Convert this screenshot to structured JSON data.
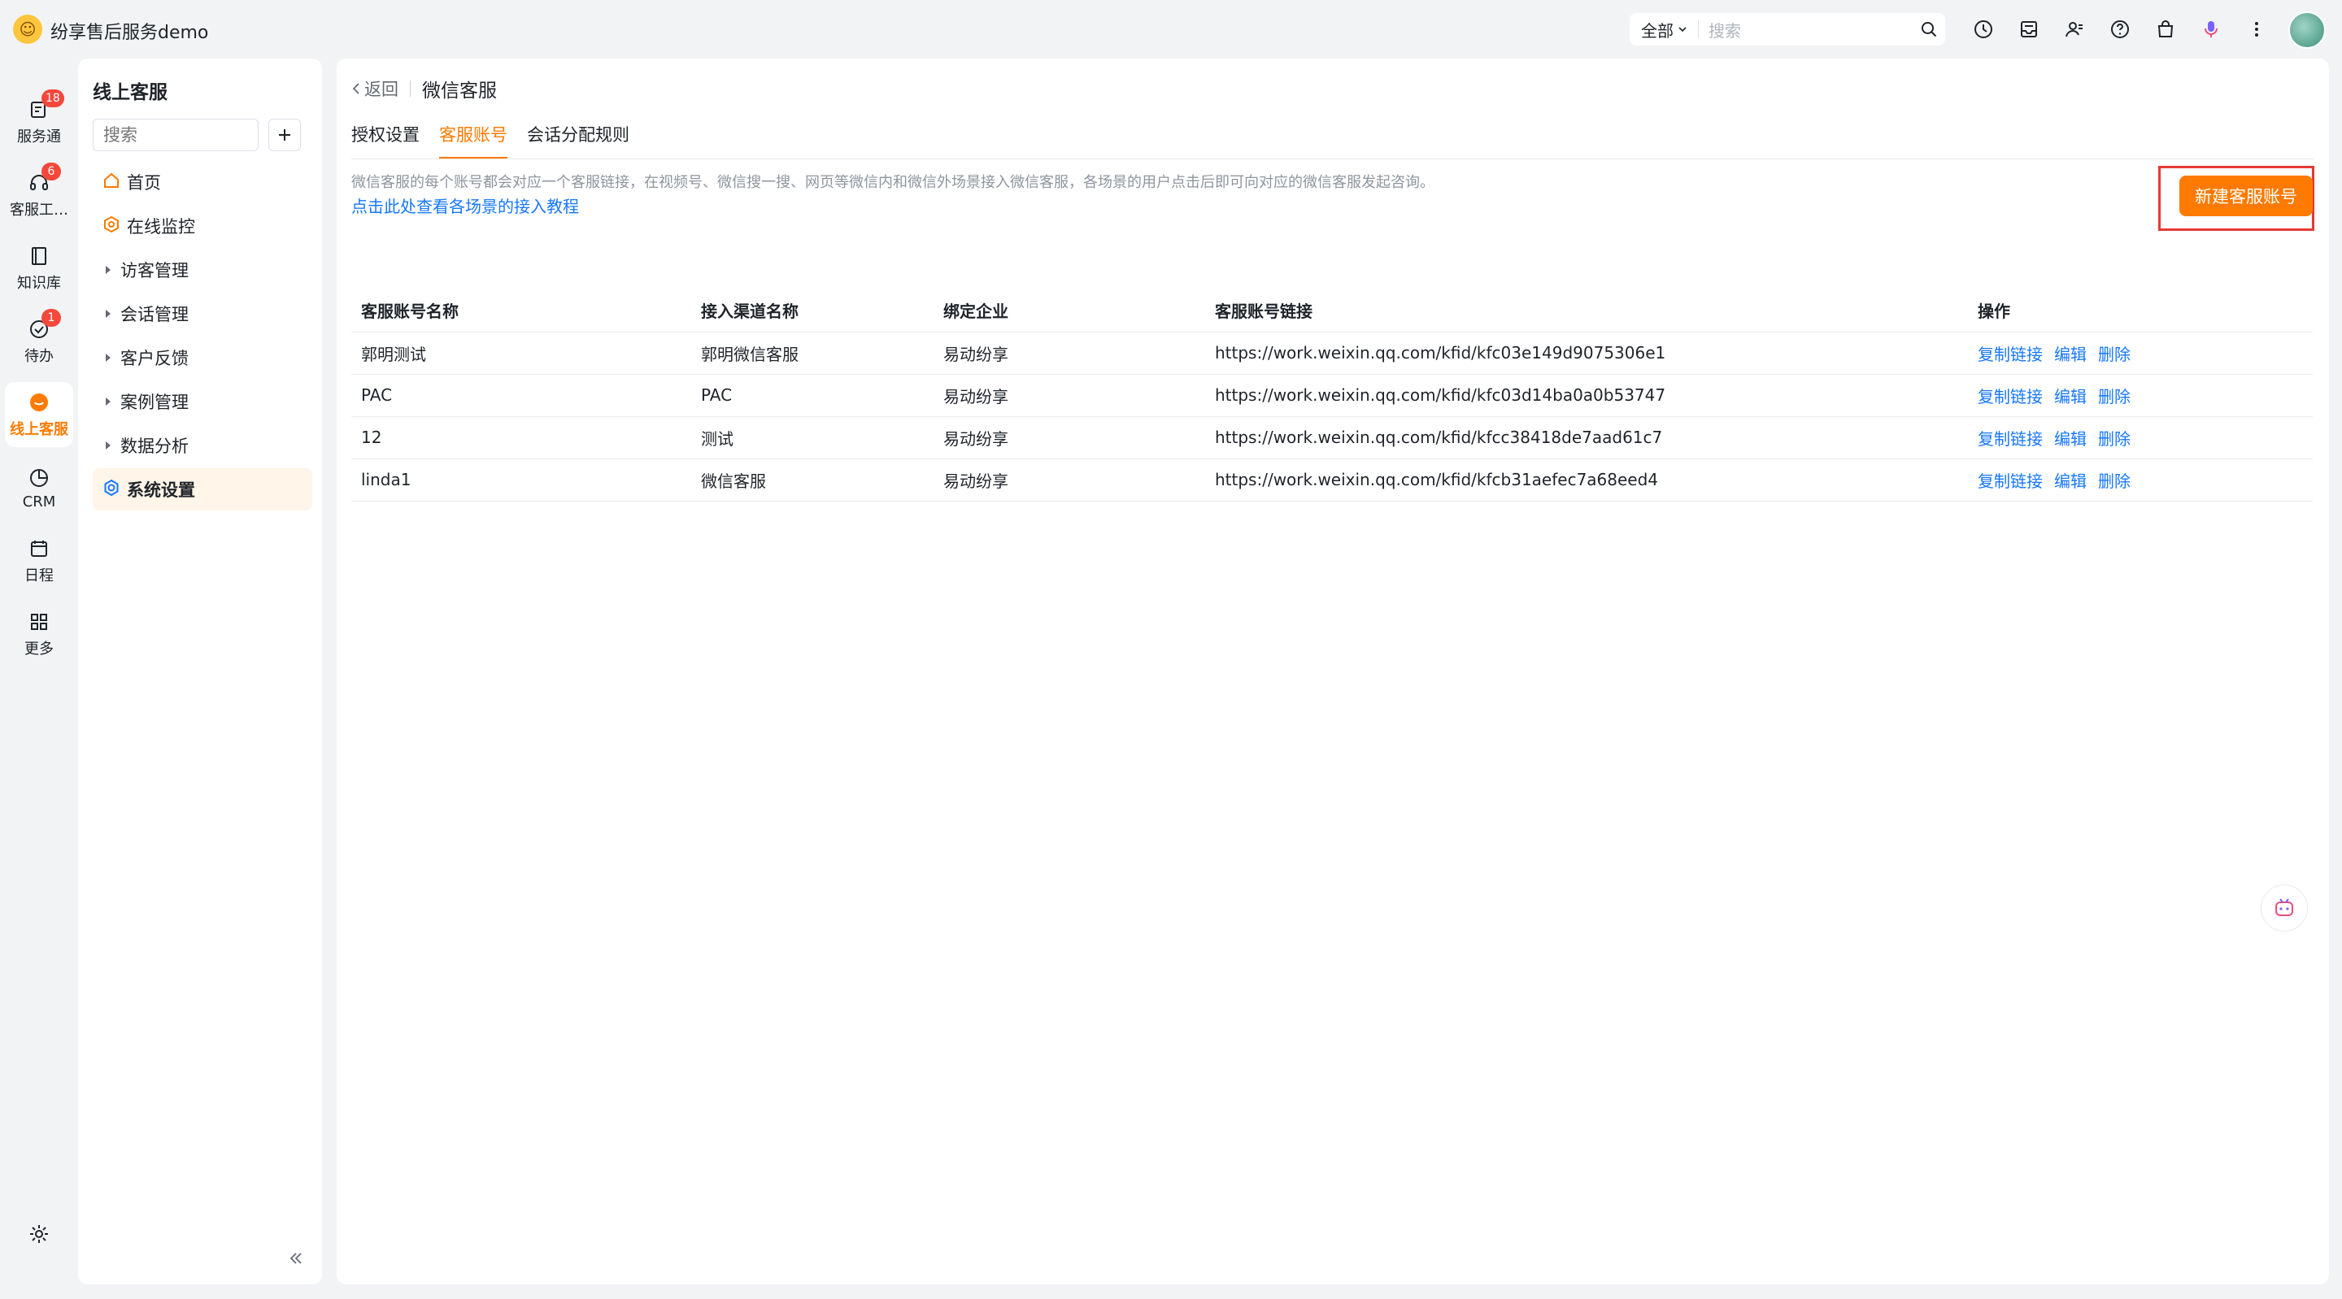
{
  "app": {
    "title": "纷享售后服务demo"
  },
  "search": {
    "scope": "全部",
    "placeholder": "搜索"
  },
  "rail": {
    "items": [
      {
        "label": "服务通",
        "badge": "18"
      },
      {
        "label": "客服工…",
        "badge": "6"
      },
      {
        "label": "知识库",
        "badge": ""
      },
      {
        "label": "待办",
        "badge": "1"
      },
      {
        "label": "线上客服",
        "badge": ""
      },
      {
        "label": "CRM",
        "badge": ""
      },
      {
        "label": "日程",
        "badge": ""
      },
      {
        "label": "更多",
        "badge": ""
      }
    ]
  },
  "sidebar": {
    "title": "线上客服",
    "search_placeholder": "搜索",
    "items": [
      {
        "label": "首页"
      },
      {
        "label": "在线监控"
      },
      {
        "label": "访客管理"
      },
      {
        "label": "会话管理"
      },
      {
        "label": "客户反馈"
      },
      {
        "label": "案例管理"
      },
      {
        "label": "数据分析"
      },
      {
        "label": "系统设置"
      }
    ]
  },
  "main": {
    "back_label": "返回",
    "title": "微信客服",
    "tabs": [
      {
        "label": "授权设置"
      },
      {
        "label": "客服账号"
      },
      {
        "label": "会话分配规则"
      }
    ],
    "description": "微信客服的每个账号都会对应一个客服链接，在视频号、微信搜一搜、网页等微信内和微信外场景接入微信客服，各场景的用户点击后即可向对应的微信客服发起咨询。",
    "tutorial_link": "点击此处查看各场景的接入教程",
    "new_button": "新建客服账号",
    "table": {
      "headers": [
        "客服账号名称",
        "接入渠道名称",
        "绑定企业",
        "客服账号链接",
        "操作"
      ],
      "rows": [
        {
          "name": "郭明测试",
          "channel": "郭明微信客服",
          "company": "易动纷享",
          "link": "https://work.weixin.qq.com/kfid/kfc03e149d9075306e1"
        },
        {
          "name": "PAC",
          "channel": "PAC",
          "company": "易动纷享",
          "link": "https://work.weixin.qq.com/kfid/kfc03d14ba0a0b53747"
        },
        {
          "name": "12",
          "channel": "测试",
          "company": "易动纷享",
          "link": "https://work.weixin.qq.com/kfid/kfcc38418de7aad61c7"
        },
        {
          "name": "linda1",
          "channel": "微信客服",
          "company": "易动纷享",
          "link": "https://work.weixin.qq.com/kfid/kfcb31aefec7a68eed4"
        }
      ],
      "ops": {
        "copy": "复制链接",
        "edit": "编辑",
        "delete": "删除"
      }
    }
  },
  "colors": {
    "accent": "#ff7a00",
    "link": "#1677ff",
    "badge": "#f5483b",
    "highlight_frame": "#e53935"
  }
}
